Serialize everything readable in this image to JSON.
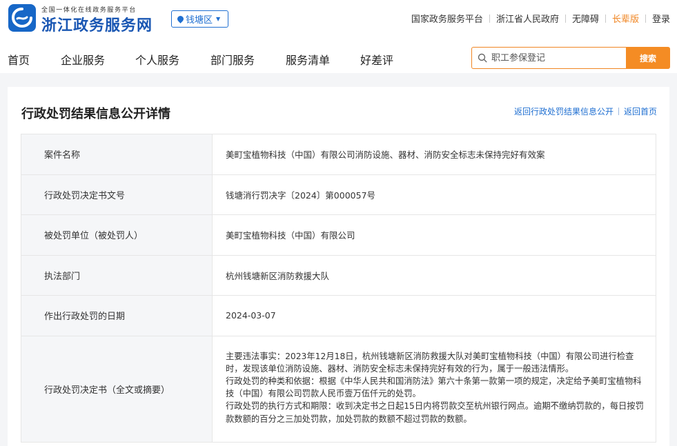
{
  "header": {
    "brand_subtitle": "全国一体化在线政务服务平台",
    "brand_title": "浙江政务服务网",
    "region": "钱塘区",
    "top_links": [
      "国家政务服务平台",
      "浙江省人民政府",
      "无障碍",
      "长辈版",
      "登录"
    ]
  },
  "nav": {
    "items": [
      "首页",
      "企业服务",
      "个人服务",
      "部门服务",
      "服务清单",
      "好差评"
    ],
    "search_placeholder": "职工参保登记",
    "search_button": "搜索"
  },
  "page": {
    "title": "行政处罚结果信息公开详情",
    "back_links": [
      "返回行政处罚结果信息公开",
      "返回首页"
    ]
  },
  "details": {
    "rows": [
      {
        "label": "案件名称",
        "value": "美町宝植物科技（中国）有限公司消防设施、器材、消防安全标志未保持完好有效案"
      },
      {
        "label": "行政处罚决定书文号",
        "value": "钱塘消行罚决字〔2024〕第000057号"
      },
      {
        "label": "被处罚单位（被处罚人）",
        "value": "美町宝植物科技（中国）有限公司"
      },
      {
        "label": "执法部门",
        "value": "杭州钱塘新区消防救援大队"
      },
      {
        "label": "作出行政处罚的日期",
        "value": "2024-03-07"
      }
    ],
    "decision": {
      "label": "行政处罚决定书（全文或摘要）",
      "paragraphs": [
        "主要违法事实：2023年12月18日，杭州钱塘新区消防救援大队对美町宝植物科技（中国）有限公司进行检查时，发现该单位消防设施、器材、消防安全标志未保持完好有效的行为，属于一般违法情形。",
        "行政处罚的种类和依据：根据《中华人民共和国消防法》第六十条第一款第一项的规定，决定给予美町宝植物科技（中国）有限公司罚款人民币壹万伍仟元的处罚。",
        "行政处罚的执行方式和期限：收到决定书之日起15日内将罚款交至杭州银行网点。逾期不缴纳罚款的，每日按罚款数额的百分之三加处罚款，加处罚款的数额不超过罚款的数额。"
      ]
    }
  },
  "colors": {
    "brand_blue": "#1a57b3",
    "link_blue": "#1f6fd1",
    "accent_orange": "#f48c24"
  }
}
